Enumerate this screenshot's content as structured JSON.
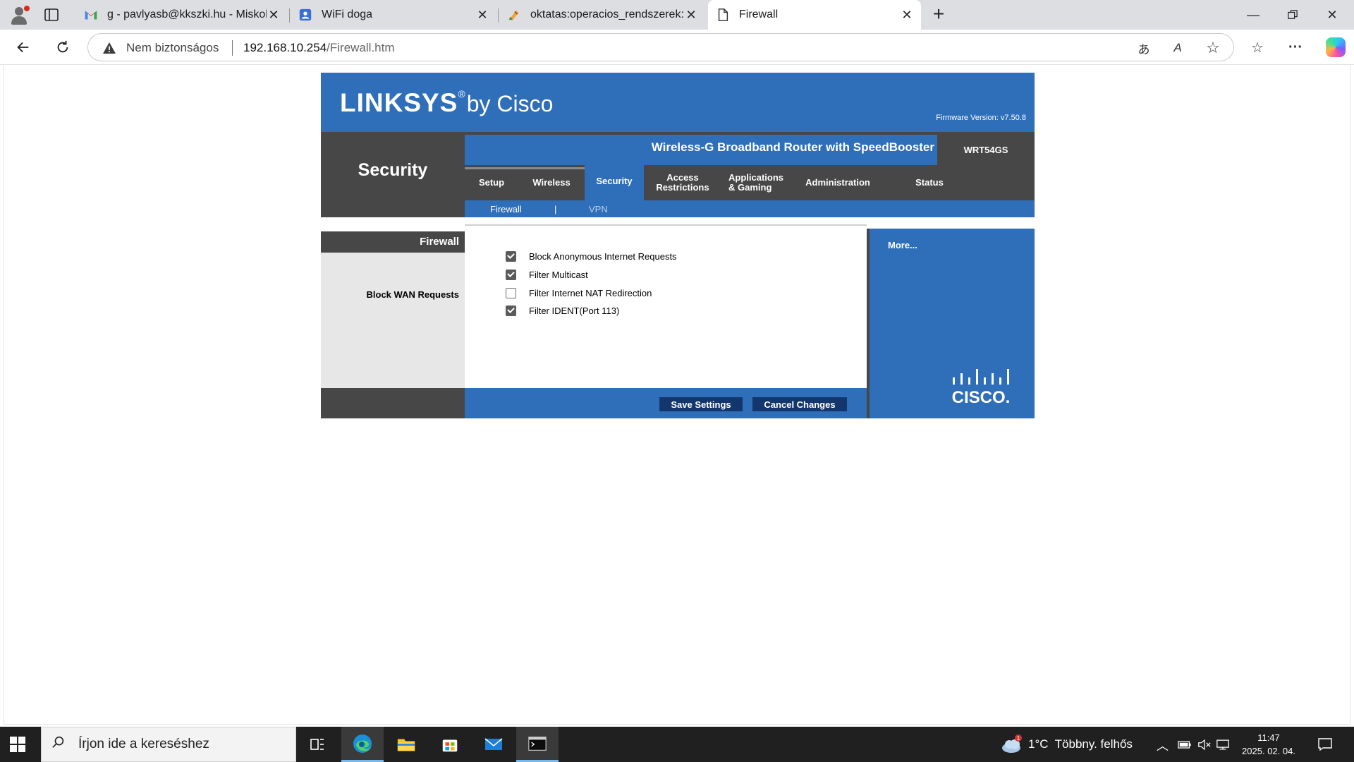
{
  "browser": {
    "tabs": [
      {
        "title": "g - pavlyasb@kkszki.hu - Miskolci",
        "icon": "gmail-icon"
      },
      {
        "title": "WiFi doga",
        "icon": "forms-icon"
      },
      {
        "title": "oktatas:operacios_rendszerek:windo",
        "icon": "wiki-icon"
      },
      {
        "title": "Firewall",
        "icon": "page-icon",
        "active": true
      }
    ],
    "address": {
      "security_label": "Nem biztonságos",
      "host": "192.168.10.254",
      "path": "/Firewall.htm"
    }
  },
  "router": {
    "brand": "LINKSYS",
    "brand_suffix": "by Cisco",
    "registered": "®",
    "firmware": "Firmware Version: v7.50.8",
    "section": "Security",
    "product": "Wireless-G Broadband Router with SpeedBooster",
    "model": "WRT54GS",
    "tabs": [
      {
        "label": "Setup"
      },
      {
        "label": "Wireless"
      },
      {
        "label": "Security",
        "active": true
      },
      {
        "label": "Access Restrictions"
      },
      {
        "label": "Applications & Gaming"
      },
      {
        "label": "Administration"
      },
      {
        "label": "Status"
      }
    ],
    "subtabs": {
      "firewall": "Firewall",
      "separator": "|",
      "vpn": "VPN"
    },
    "panel_title": "Firewall",
    "group_label": "Block WAN Requests",
    "options": [
      {
        "label": "Block Anonymous Internet Requests",
        "checked": true
      },
      {
        "label": "Filter Multicast",
        "checked": true
      },
      {
        "label": "Filter Internet NAT Redirection",
        "checked": false
      },
      {
        "label": "Filter IDENT(Port 113)",
        "checked": true
      }
    ],
    "more": "More...",
    "save": "Save Settings",
    "cancel": "Cancel Changes",
    "cisco_logo_text": "CISCO."
  },
  "taskbar": {
    "search_placeholder": "Írjon ide a kereséshez",
    "weather": "1°C  Többny. felhős",
    "weather_badge": "1",
    "time": "11:47",
    "date": "2025. 02. 04."
  },
  "colors": {
    "linksys_blue": "#2f6fb9",
    "linksys_dark": "#474747",
    "button_navy": "#13366d"
  }
}
